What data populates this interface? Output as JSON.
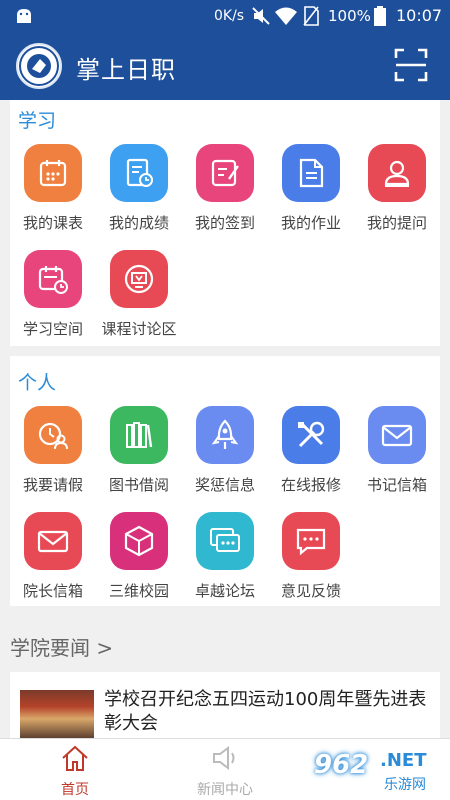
{
  "status_bar": {
    "network_speed": "0K/s",
    "battery": "100%",
    "time": "10:07"
  },
  "app_bar": {
    "title": "掌上日职"
  },
  "study": {
    "title": "学习",
    "items": [
      {
        "label": "我的课表",
        "icon": "calendar-icon",
        "color": "#f08040"
      },
      {
        "label": "我的成绩",
        "icon": "report-icon",
        "color": "#3ea0f0"
      },
      {
        "label": "我的签到",
        "icon": "sign-in-icon",
        "color": "#e8457c"
      },
      {
        "label": "我的作业",
        "icon": "homework-icon",
        "color": "#4a7de8"
      },
      {
        "label": "我的提问",
        "icon": "question-icon",
        "color": "#e84a55"
      },
      {
        "label": "学习空间",
        "icon": "study-space-icon",
        "color": "#e8457c"
      },
      {
        "label": "课程讨论区",
        "icon": "discussion-icon",
        "color": "#e84a55"
      }
    ]
  },
  "personal": {
    "title": "个人",
    "items": [
      {
        "label": "我要请假",
        "icon": "leave-icon",
        "color": "#f08040"
      },
      {
        "label": "图书借阅",
        "icon": "books-icon",
        "color": "#3cb860"
      },
      {
        "label": "奖惩信息",
        "icon": "rocket-icon",
        "color": "#6a8cf0"
      },
      {
        "label": "在线报修",
        "icon": "tools-icon",
        "color": "#4a7de8"
      },
      {
        "label": "书记信箱",
        "icon": "mail-icon",
        "color": "#6a8cf0"
      },
      {
        "label": "院长信箱",
        "icon": "mail-icon",
        "color": "#e84a55"
      },
      {
        "label": "三维校园",
        "icon": "cube-icon",
        "color": "#d8307a"
      },
      {
        "label": "卓越论坛",
        "icon": "forum-icon",
        "color": "#30b8d0"
      },
      {
        "label": "意见反馈",
        "icon": "feedback-icon",
        "color": "#e84a55"
      }
    ]
  },
  "news": {
    "header": "学院要闻 >",
    "headline": "学校召开纪念五四运动100周年暨先进表彰大会"
  },
  "bottom_nav": {
    "home": "首页",
    "news": "新闻中心"
  },
  "watermark": {
    "num": "962",
    "net": ".NET",
    "sub": "乐游网"
  }
}
